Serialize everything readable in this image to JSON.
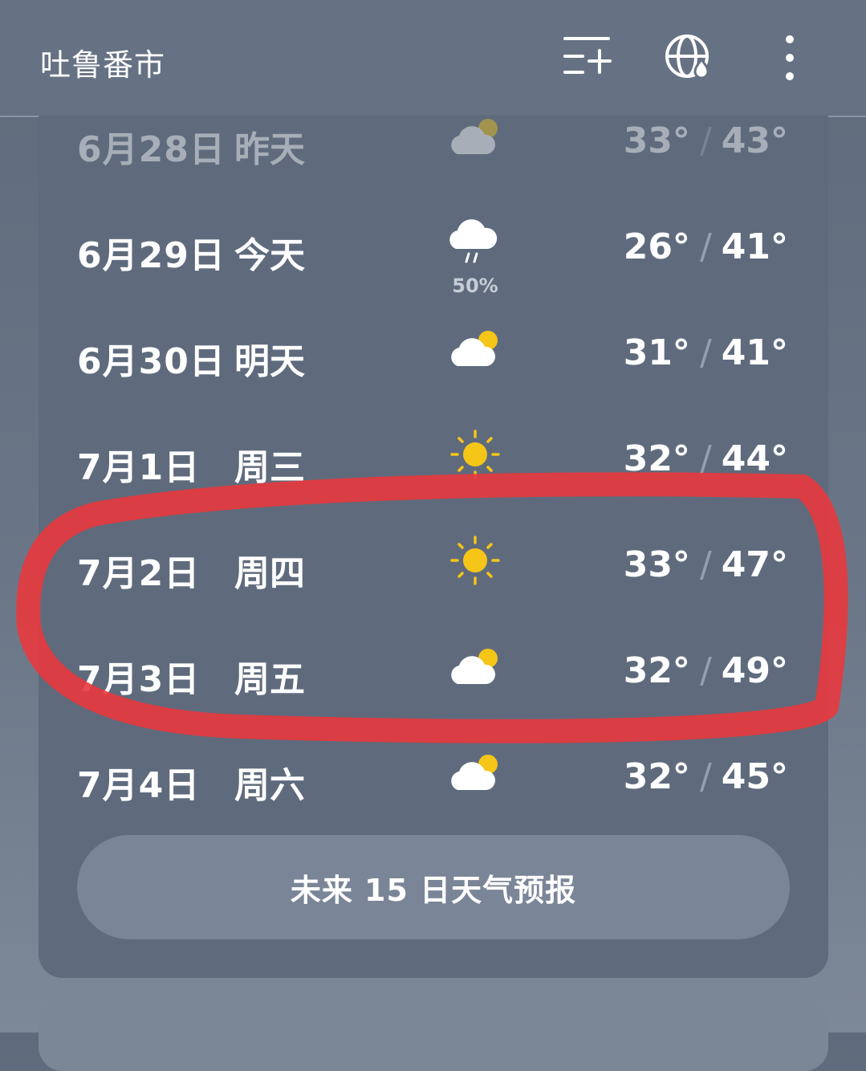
{
  "header": {
    "city": "吐鲁番市",
    "icons": [
      "add-list-icon",
      "globe-rain-icon",
      "more-vert-icon"
    ]
  },
  "forecast": [
    {
      "date": "6月28日",
      "day": "昨天",
      "icon": "partly-cloudy-icon",
      "low": "33°",
      "high": "43°",
      "faded": true
    },
    {
      "date": "6月29日",
      "day": "今天",
      "icon": "rain-cloud-icon",
      "pop": "50%",
      "low": "26°",
      "high": "41°"
    },
    {
      "date": "6月30日",
      "day": "明天",
      "icon": "partly-cloudy-icon",
      "low": "31°",
      "high": "41°"
    },
    {
      "date": "7月1日",
      "day": "周三",
      "icon": "sun-icon",
      "low": "32°",
      "high": "44°"
    },
    {
      "date": "7月2日",
      "day": "周四",
      "icon": "sun-icon",
      "low": "33°",
      "high": "47°"
    },
    {
      "date": "7月3日",
      "day": "周五",
      "icon": "partly-cloudy-icon",
      "low": "32°",
      "high": "49°"
    },
    {
      "date": "7月4日",
      "day": "周六",
      "icon": "partly-cloudy-icon",
      "low": "32°",
      "high": "45°"
    }
  ],
  "forecast_button": "未来 15 日天气预报",
  "colors": {
    "sun": "#f5c518",
    "annotation": "#e8383d"
  }
}
